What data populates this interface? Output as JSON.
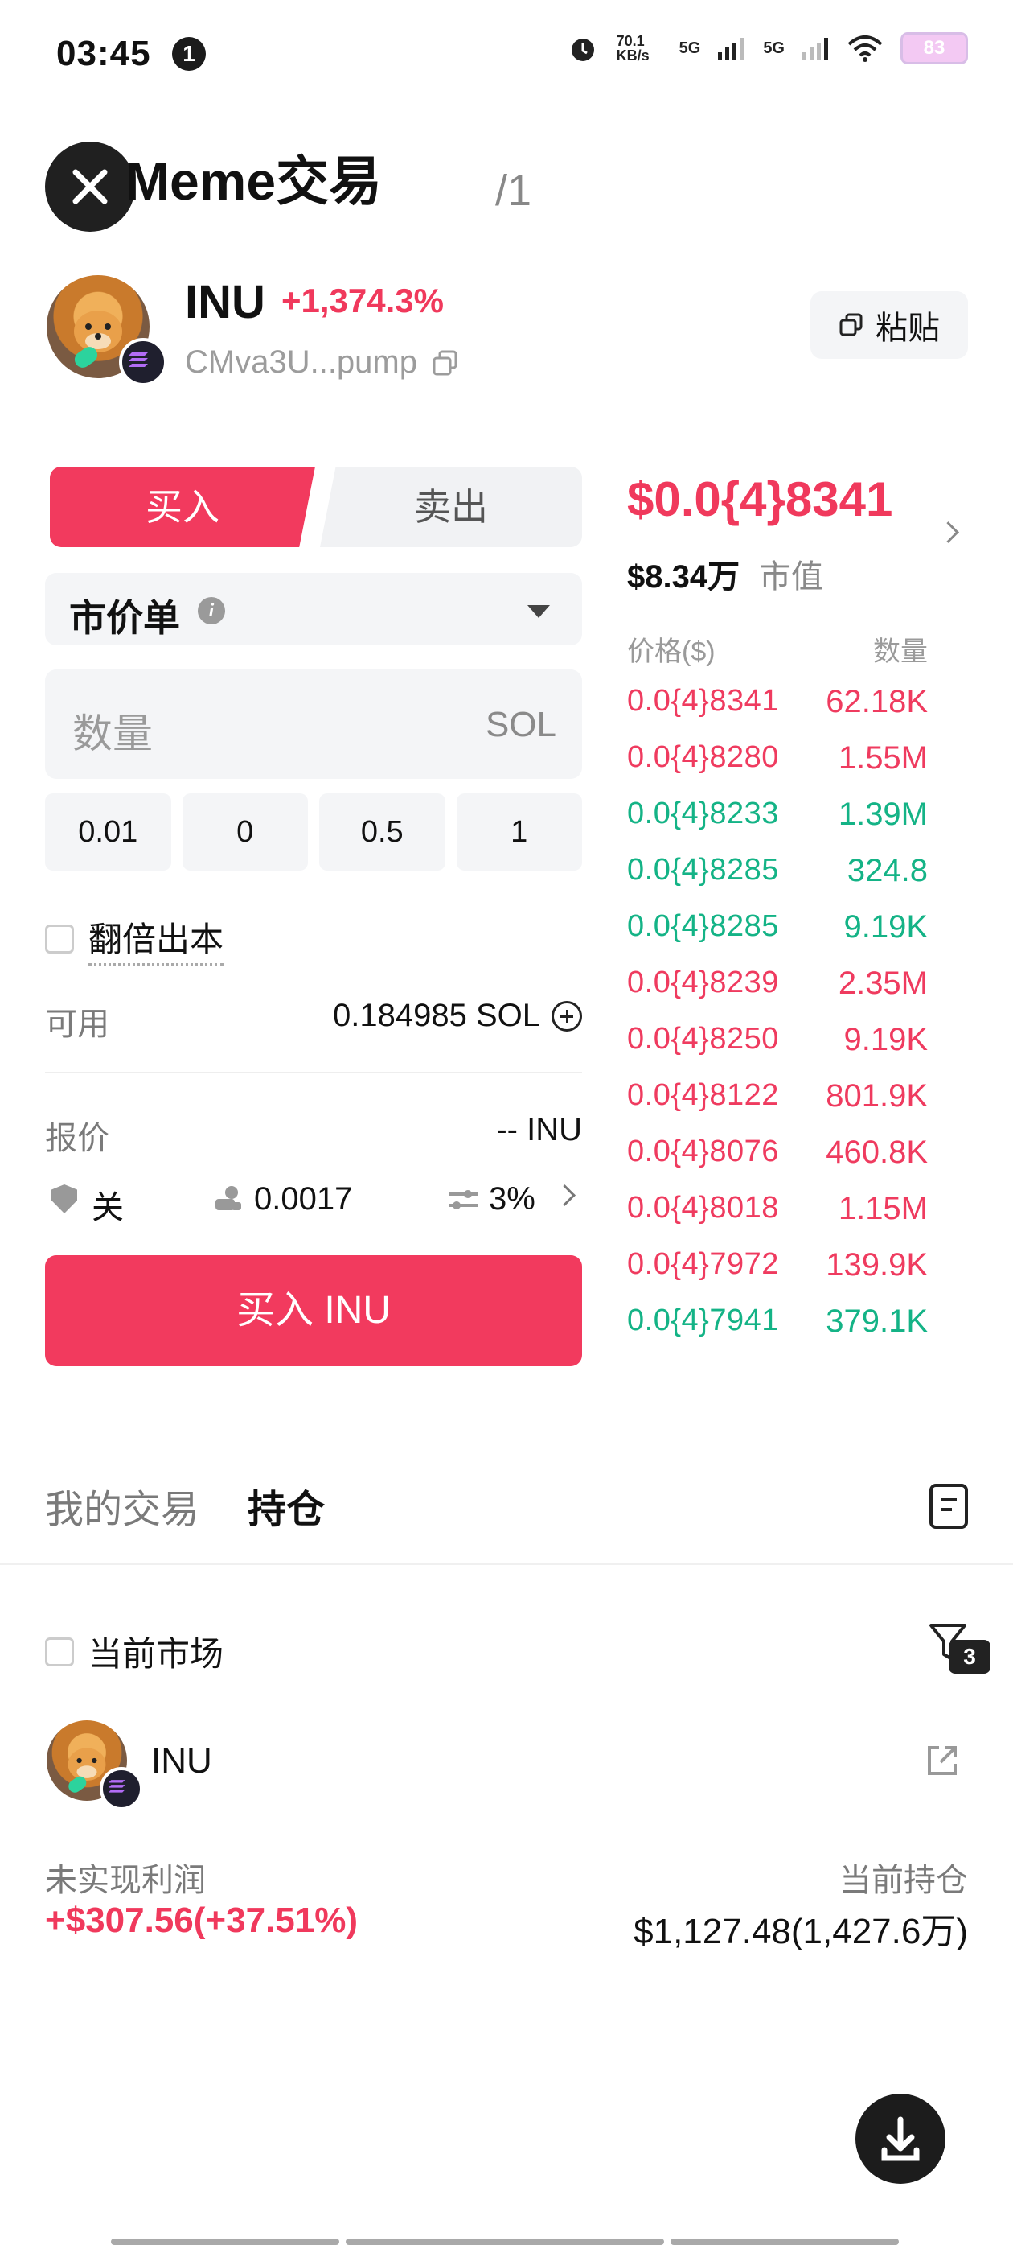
{
  "status_bar": {
    "time": "03:45",
    "notification_count": "1",
    "network_1": "5G",
    "network_2": "5G",
    "speed": "70.1 KB/s",
    "battery": "83"
  },
  "header": {
    "title": "Meme交易",
    "page_counter": "/1"
  },
  "token": {
    "symbol": "INU",
    "change": "+1,374.3%",
    "address": "CMva3U...pump",
    "paste_label": "粘贴"
  },
  "trade_form": {
    "buy_tab": "买入",
    "sell_tab": "卖出",
    "order_type": "市价单",
    "amount_placeholder": "数量",
    "amount_unit": "SOL",
    "presets": [
      "0.01",
      "0",
      "0.5",
      "1"
    ],
    "double_label": "翻倍出本",
    "available_label": "可用",
    "available_value": "0.184985 SOL",
    "quote_label": "报价",
    "quote_value": "-- INU",
    "mev_label": "关",
    "gas_value": "0.0017",
    "slippage_value": "3%",
    "buy_button": "买入 INU"
  },
  "order_book": {
    "price": "$0.0{4}8341",
    "market_cap": "$8.34万",
    "market_cap_label": "市值",
    "col_price": "价格($)",
    "col_qty": "数量",
    "rows": [
      {
        "price": "0.0{4}8341",
        "qty": "62.18K",
        "side": "sell"
      },
      {
        "price": "0.0{4}8280",
        "qty": "1.55M",
        "side": "sell"
      },
      {
        "price": "0.0{4}8233",
        "qty": "1.39M",
        "side": "buy"
      },
      {
        "price": "0.0{4}8285",
        "qty": "324.8",
        "side": "buy"
      },
      {
        "price": "0.0{4}8285",
        "qty": "9.19K",
        "side": "buy"
      },
      {
        "price": "0.0{4}8239",
        "qty": "2.35M",
        "side": "sell"
      },
      {
        "price": "0.0{4}8250",
        "qty": "9.19K",
        "side": "sell"
      },
      {
        "price": "0.0{4}8122",
        "qty": "801.9K",
        "side": "sell"
      },
      {
        "price": "0.0{4}8076",
        "qty": "460.8K",
        "side": "sell"
      },
      {
        "price": "0.0{4}8018",
        "qty": "1.15M",
        "side": "sell"
      },
      {
        "price": "0.0{4}7972",
        "qty": "139.9K",
        "side": "sell"
      },
      {
        "price": "0.0{4}7941",
        "qty": "379.1K",
        "side": "buy"
      }
    ]
  },
  "bottom": {
    "tab_trades": "我的交易",
    "tab_holdings": "持仓",
    "current_market": "当前市场",
    "filter_count": "3",
    "holding": {
      "symbol": "INU",
      "pnl_label": "未实现利润",
      "pnl_value": "+$307.56(+37.51%)",
      "position_label": "当前持仓",
      "position_value": "$1,127.48(1,427.6万)"
    }
  },
  "colors": {
    "accent": "#f23a5e",
    "sell": "#ef3b5f",
    "buy": "#14b386"
  }
}
